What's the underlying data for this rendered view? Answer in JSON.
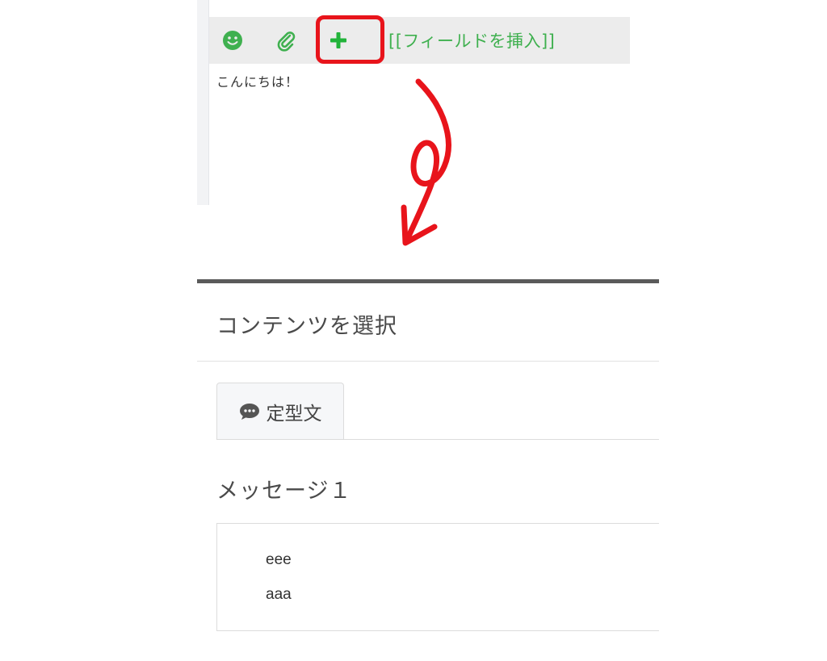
{
  "editor": {
    "toolbar": {
      "emoji_icon": "smiley-icon",
      "attach_icon": "paperclip-icon",
      "add_icon": "plus-icon",
      "insert_field_label": "[[フィールドを挿入]]"
    },
    "body_text": "こんにちは！",
    "accent_color": "#3fb04f",
    "highlight_color": "#e8141b"
  },
  "arrow": {
    "icon": "hand-drawn-down-arrow",
    "color": "#e8141b"
  },
  "picker": {
    "title": "コンテンツを選択",
    "tabs": [
      {
        "label": "定型文",
        "icon": "speech-bubble-icon"
      }
    ],
    "section_heading": "メッセージ１",
    "message": {
      "lines": [
        "eee",
        "aaa"
      ]
    }
  }
}
